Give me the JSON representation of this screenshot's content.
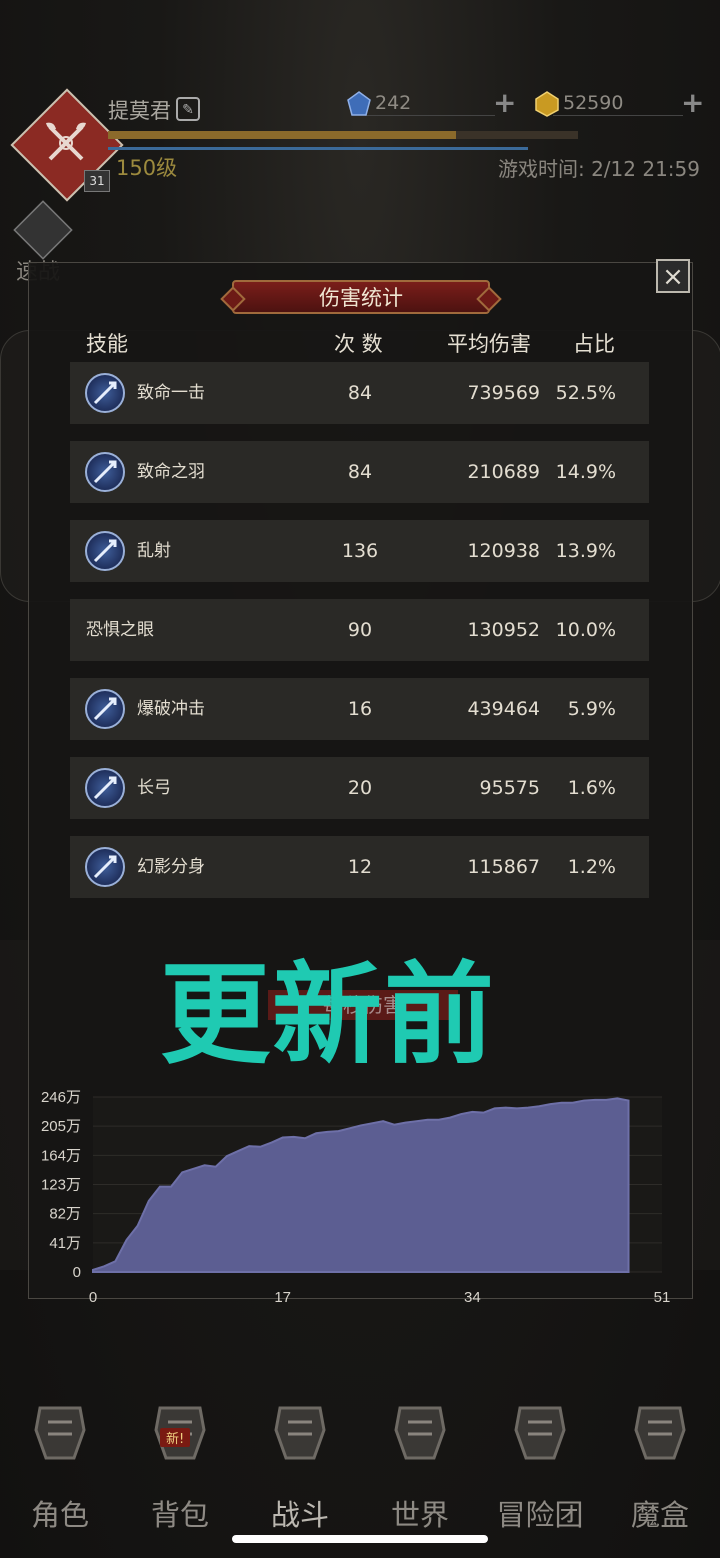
{
  "player": {
    "name": "提莫君",
    "level": "150级",
    "badge_level": "31",
    "xp_progress": 0.74
  },
  "currencies": [
    {
      "icon": "blue-crystal-icon",
      "value": "242"
    },
    {
      "icon": "gold-crystal-icon",
      "value": "52590"
    }
  ],
  "game_time": "游戏时间: 2/12 21:59",
  "speed_battle_label": "速战",
  "dialog": {
    "title": "伤害统计",
    "close_icon": "×",
    "columns": [
      "技能",
      "次 数",
      "平均伤害",
      "占比"
    ],
    "rows": [
      {
        "skill": "致命一击",
        "count": "84",
        "avg": "739569",
        "pct": "52.5%",
        "icon": "sword-strike-icon"
      },
      {
        "skill": "致命之羽",
        "count": "84",
        "avg": "210689",
        "pct": "14.9%",
        "icon": "feather-sword-icon"
      },
      {
        "skill": "乱射",
        "count": "136",
        "avg": "120938",
        "pct": "13.9%",
        "icon": "multishot-icon"
      },
      {
        "skill": "恐惧之眼",
        "count": "90",
        "avg": "130952",
        "pct": "10.0%",
        "icon": ""
      },
      {
        "skill": "爆破冲击",
        "count": "16",
        "avg": "439464",
        "pct": "5.9%",
        "icon": "blast-icon"
      },
      {
        "skill": "长弓",
        "count": "20",
        "avg": "95575",
        "pct": "1.6%",
        "icon": "longbow-icon"
      },
      {
        "skill": "幻影分身",
        "count": "12",
        "avg": "115867",
        "pct": "1.2%",
        "icon": "phantom-icon"
      }
    ],
    "overlay_text": "更新前",
    "chart_title": "每秒伤害"
  },
  "chart_data": {
    "type": "area",
    "title": "",
    "x_ticks": [
      "0",
      "17",
      "34",
      "51"
    ],
    "y_ticks": [
      "0",
      "41万",
      "82万",
      "123万",
      "164万",
      "205万",
      "246万"
    ],
    "xlim": [
      0,
      51
    ],
    "ylim": [
      0,
      246
    ],
    "x": [
      0,
      1,
      2,
      3,
      4,
      5,
      6,
      7,
      8,
      9,
      10,
      11,
      12,
      13,
      14,
      15,
      16,
      17,
      18,
      19,
      20,
      21,
      22,
      23,
      24,
      25,
      26,
      27,
      28,
      29,
      30,
      31,
      32,
      33,
      34,
      35,
      36,
      37,
      38,
      39,
      40,
      41,
      42,
      43,
      44,
      45,
      46,
      47,
      48
    ],
    "y": [
      3,
      8,
      15,
      45,
      65,
      100,
      120,
      120,
      140,
      145,
      150,
      148,
      163,
      170,
      177,
      176,
      182,
      189,
      190,
      188,
      195,
      197,
      198,
      202,
      206,
      209,
      212,
      207,
      210,
      212,
      214,
      214,
      217,
      222,
      225,
      224,
      230,
      231,
      230,
      231,
      233,
      236,
      238,
      238,
      241,
      242,
      242,
      244,
      241
    ],
    "series_color": "#5c5e92"
  },
  "nav": [
    {
      "label": "角色",
      "icon": "helmet-icon"
    },
    {
      "label": "背包",
      "icon": "backpack-icon",
      "badge": "新!"
    },
    {
      "label": "战斗",
      "icon": "battle-icon"
    },
    {
      "label": "世界",
      "icon": "world-map-icon"
    },
    {
      "label": "冒险团",
      "icon": "castle-icon"
    },
    {
      "label": "魔盒",
      "icon": "magic-box-icon"
    }
  ]
}
